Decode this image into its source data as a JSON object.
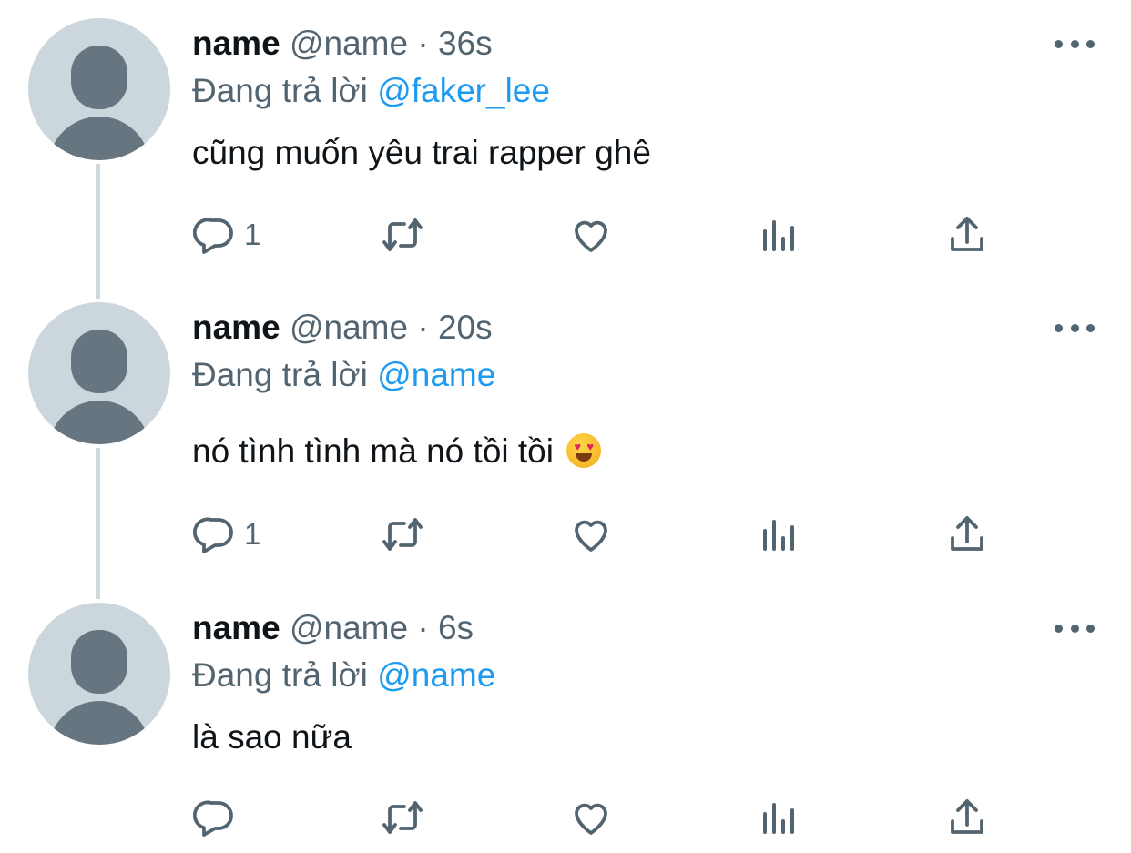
{
  "tweets": [
    {
      "display_name": "name",
      "handle": "@name",
      "separator": "·",
      "time": "36s",
      "reply_prefix": "Đang trả lời",
      "reply_to": "@faker_lee",
      "text": "cũng muốn yêu trai rapper ghê",
      "reply_count": "1",
      "emoji": ""
    },
    {
      "display_name": "name",
      "handle": "@name",
      "separator": "·",
      "time": "20s",
      "reply_prefix": "Đang trả lời",
      "reply_to": "@name",
      "text": "nó tình tình mà nó tồi tồi",
      "reply_count": "1",
      "emoji": "smiling-face-with-heart-eyes"
    },
    {
      "display_name": "name",
      "handle": "@name",
      "separator": "·",
      "time": "6s",
      "reply_prefix": "Đang trả lời",
      "reply_to": "@name",
      "text": "là sao nữa",
      "reply_count": "",
      "emoji": ""
    }
  ],
  "icons": {
    "reply": "reply-icon",
    "retweet": "retweet-icon",
    "like": "heart-icon",
    "views": "analytics-icon",
    "share": "share-icon",
    "more": "more-icon"
  },
  "colors": {
    "mention": "#1d9bf0",
    "secondary_text": "#536471",
    "avatar_bg": "#ccd6dd",
    "avatar_fg": "#66757f",
    "thread_line": "#cfd9de"
  }
}
